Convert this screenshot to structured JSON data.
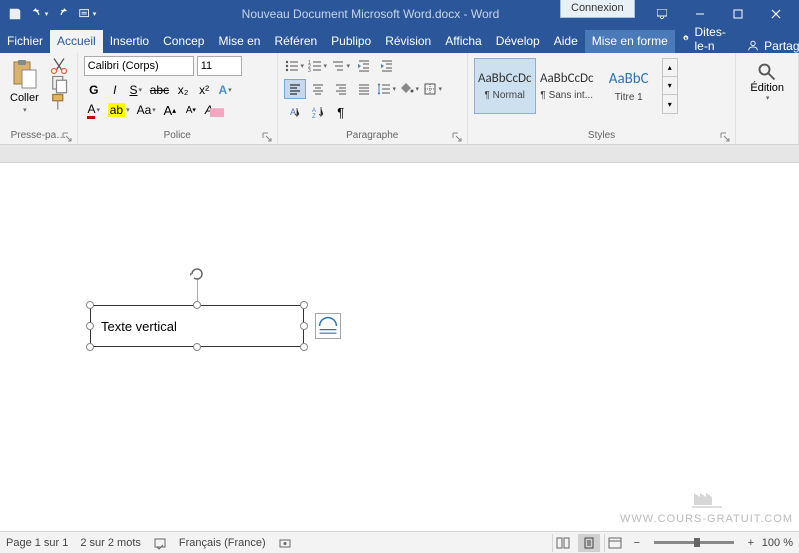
{
  "titlebar": {
    "document_title": "Nouveau Document Microsoft Word.docx  -  Word",
    "connexion": "Connexion"
  },
  "tabs": {
    "items": [
      "Fichier",
      "Accueil",
      "Insertio",
      "Concep",
      "Mise en",
      "Référen",
      "Publipo",
      "Révision",
      "Afficha",
      "Dévelop",
      "Aide",
      "Mise en forme"
    ],
    "tellme": "Dites-le-n",
    "share": "Partager"
  },
  "ribbon": {
    "clipboard": {
      "paste": "Coller",
      "label": "Presse-pa…"
    },
    "font": {
      "name": "Calibri (Corps)",
      "size": "11",
      "label": "Police",
      "bold": "G",
      "italic": "I",
      "underline": "S",
      "strike": "abc",
      "sub": "x₂",
      "sup": "x²"
    },
    "paragraph": {
      "label": "Paragraphe"
    },
    "styles": {
      "label": "Styles",
      "items": [
        {
          "preview": "AaBbCcDc",
          "name": "¶ Normal"
        },
        {
          "preview": "AaBbCcDc",
          "name": "¶ Sans int..."
        },
        {
          "preview": "AaBbC",
          "name": "Titre 1"
        }
      ]
    },
    "edition": {
      "label": "Édition"
    }
  },
  "document": {
    "textbox_content": "Texte vertical"
  },
  "status": {
    "page": "Page 1 sur 1",
    "words": "2 sur 2 mots",
    "lang": "Français (France)",
    "zoom": "100 %"
  },
  "watermark": "WWW.COURS-GRATUIT.COM"
}
